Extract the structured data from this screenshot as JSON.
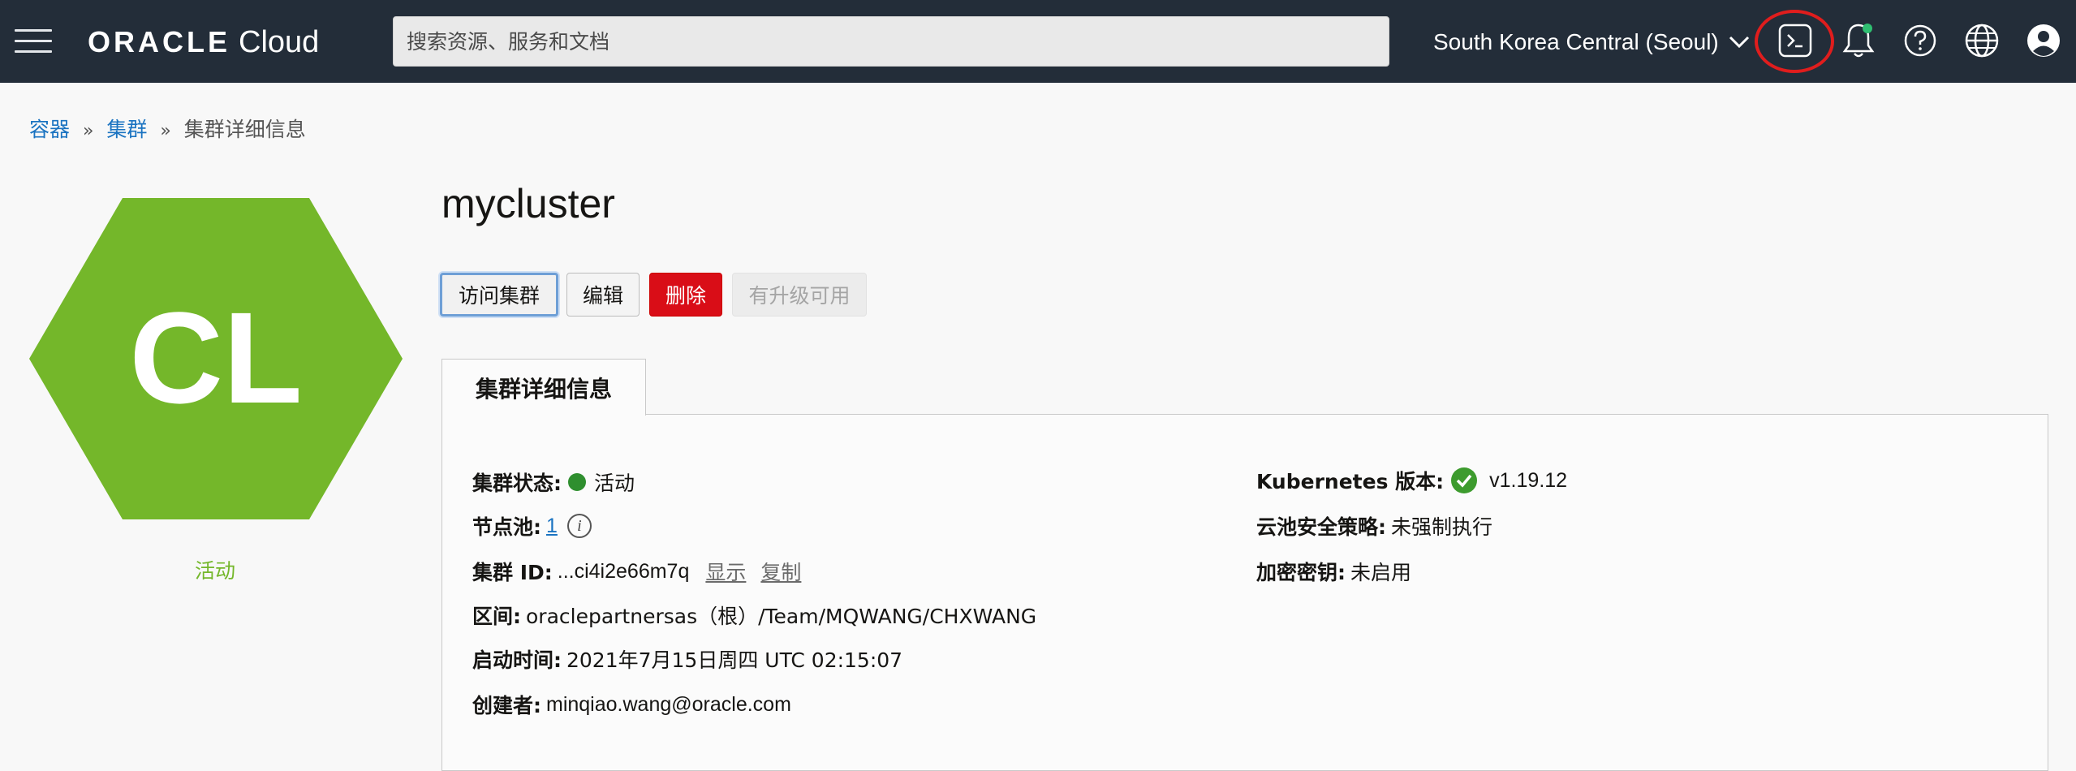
{
  "header": {
    "brand_oracle": "ORACLE",
    "brand_cloud": "Cloud",
    "search_placeholder": "搜索资源、服务和文档",
    "region": "South Korea Central (Seoul)",
    "icons": [
      "menu-icon",
      "cloud-shell-icon",
      "bell-icon",
      "help-icon",
      "globe-icon",
      "user-icon"
    ],
    "notification_dot_color": "#2fbf71",
    "highlight_color": "#e01d1d"
  },
  "breadcrumb": {
    "item1": "容器",
    "item2": "集群",
    "current": "集群详细信息",
    "sep": "»"
  },
  "hexagon": {
    "initials": "CL",
    "color": "#74b72a",
    "status": "活动"
  },
  "page": {
    "title": "mycluster"
  },
  "actions": {
    "access": "访问集群",
    "edit": "编辑",
    "delete": "删除",
    "upgrade": "有升级可用"
  },
  "tab": {
    "label": "集群详细信息"
  },
  "details": {
    "status_label": "集群状态:",
    "status_value": "活动",
    "nodepool_label": "节点池:",
    "nodepool_value": "1",
    "id_label": "集群 ID:",
    "id_value": "...ci4i2e66m7q",
    "show": "显示",
    "copy": "复制",
    "compartment_label": "区间:",
    "compartment_value": "oraclepartnersas（根）/Team/MQWANG/CHXWANG",
    "start_label": "启动时间:",
    "start_value": "2021年7月15日周四 UTC 02:15:07",
    "creator_label": "创建者:",
    "creator_value": "minqiao.wang@oracle.com",
    "k8s_label": "Kubernetes 版本:",
    "k8s_value": "v1.19.12",
    "policy_label": "云池安全策略:",
    "policy_value": "未强制执行",
    "key_label": "加密密钥:",
    "key_value": "未启用"
  }
}
